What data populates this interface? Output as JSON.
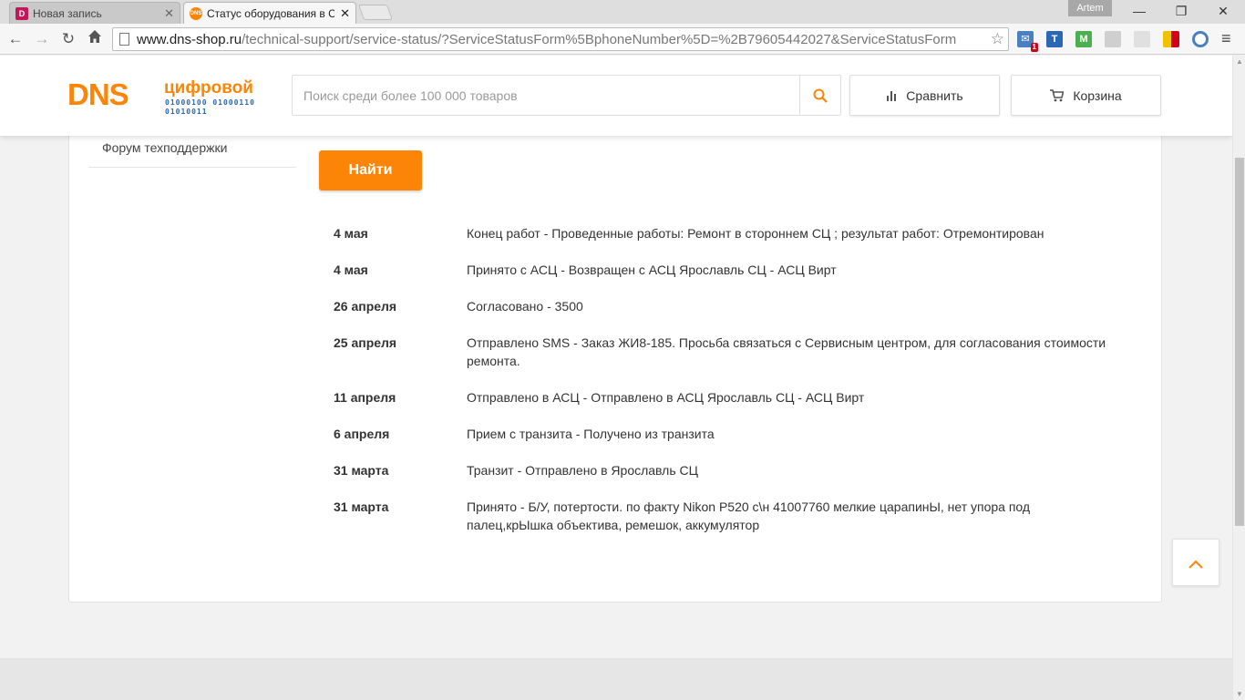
{
  "browser": {
    "tabs": [
      {
        "title": "Новая запись",
        "favicon_letter": "D",
        "close": "✕",
        "active": false
      },
      {
        "title": "Статус оборудования в С",
        "favicon_letter": "DNS",
        "close": "✕",
        "active": true
      }
    ],
    "profile_name": "Artem",
    "url_host": "www.dns-shop.ru",
    "url_path": "/technical-support/service-status/?ServiceStatusForm%5BphoneNumber%5D=%2B79605442027&ServiceStatusForm",
    "extensions": [
      {
        "icon": "mail-icon",
        "badge": "1"
      },
      {
        "icon": "translate-icon",
        "label": "T"
      },
      {
        "icon": "shield-icon",
        "label": "M"
      }
    ]
  },
  "header": {
    "logo_main": "DNS",
    "logo_tag": "цифровой",
    "logo_bits": "01000100 01000110 01010011",
    "search_placeholder": "Поиск среди более 100 000 товаров",
    "compare_label": "Сравнить",
    "cart_label": "Корзина"
  },
  "sidebar": {
    "forum_link": "Форум техподдержки"
  },
  "form": {
    "find_label": "Найти"
  },
  "history": [
    {
      "date": "4 мая",
      "text": "Конец работ - Проведенные работы: Ремонт в стороннем СЦ ; результат работ: Отремонтирован"
    },
    {
      "date": "4 мая",
      "text": "Принято с АСЦ - Возвращен с АСЦ Ярославль СЦ - АСЦ Вирт"
    },
    {
      "date": "26 апреля",
      "text": "Согласовано - 3500"
    },
    {
      "date": "25 апреля",
      "text": "Отправлено SMS - Заказ ЖИ8-185. Просьба связаться с Сервисным центром, для согласования стоимости ремонта."
    },
    {
      "date": "11 апреля",
      "text": "Отправлено в АСЦ - Отправлено в АСЦ Ярославль СЦ - АСЦ Вирт"
    },
    {
      "date": "6 апреля",
      "text": "Прием с транзита - Получено из транзита"
    },
    {
      "date": "31 марта",
      "text": "Транзит - Отправлено в Ярославль СЦ"
    },
    {
      "date": "31 марта",
      "text": "Принято - Б/У, потертости. по факту Nikon P520 с\\н 41007760 мелкие царапинЫ, нет упора под палец,крЫшка объектива, ремешок, аккумулятор"
    }
  ],
  "colors": {
    "brand_orange": "#fc8507",
    "logo_blue": "#2a68b3"
  }
}
